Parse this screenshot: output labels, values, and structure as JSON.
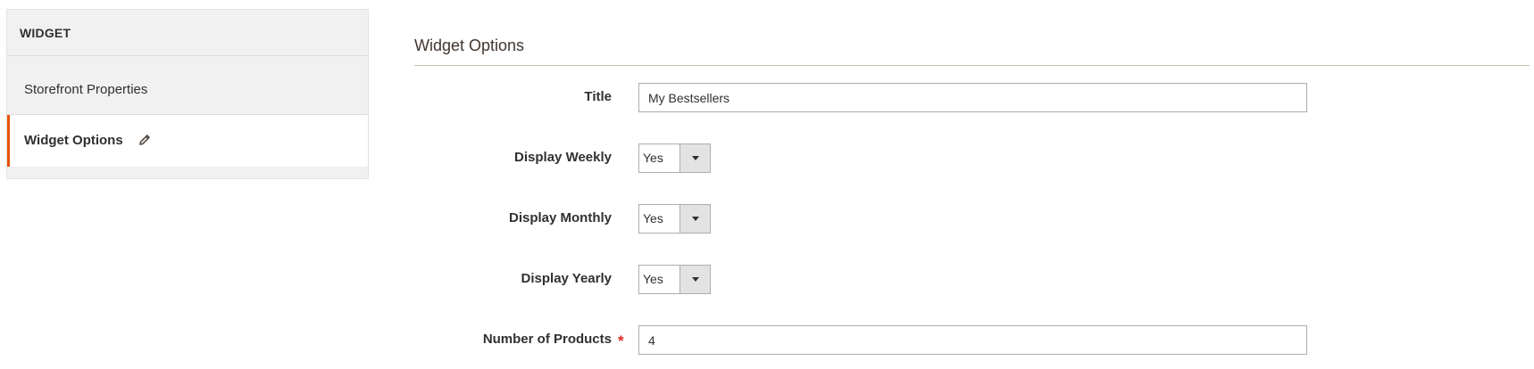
{
  "sidebar": {
    "title": "WIDGET",
    "items": [
      {
        "label": "Storefront Properties",
        "active": false
      },
      {
        "label": "Widget Options",
        "active": true,
        "icon": "pencil-edit-icon"
      }
    ],
    "active_accent": "#eb5202"
  },
  "main": {
    "section_title": "Widget Options",
    "fields": {
      "title": {
        "label": "Title",
        "value": "My Bestsellers"
      },
      "display_weekly": {
        "label": "Display Weekly",
        "value": "Yes"
      },
      "display_monthly": {
        "label": "Display Monthly",
        "value": "Yes"
      },
      "display_yearly": {
        "label": "Display Yearly",
        "value": "Yes"
      },
      "number_of_products": {
        "label": "Number of Products",
        "value": "4",
        "required": true,
        "required_mark": "*"
      }
    }
  }
}
